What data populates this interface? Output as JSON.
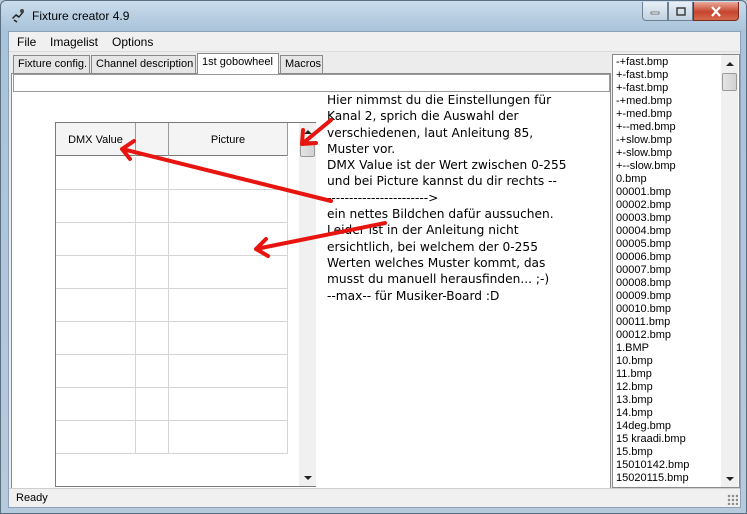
{
  "window": {
    "title": "Fixture creator 4.9"
  },
  "menu": [
    "File",
    "Imagelist",
    "Options"
  ],
  "tabs": [
    {
      "label": "Fixture config.",
      "active": false
    },
    {
      "label": "Channel description",
      "active": false
    },
    {
      "label": "1st gobowheel",
      "active": true
    },
    {
      "label": "Macros",
      "active": false
    }
  ],
  "grid": {
    "headers": {
      "dmx": "DMX Value",
      "mid": "",
      "picture": "Picture"
    },
    "empty_rows": 9
  },
  "note_lines": [
    "Hier nimmst du die Einstellungen für",
    "Kanal 2, sprich die Auswahl der",
    "verschiedenen, laut Anleitung 85,",
    "Muster vor.",
    "",
    "DMX Value ist der Wert zwischen 0-255",
    "und bei Picture kannst du dir rechts --",
    "-----------------------",
    "ein nettes Bildchen dafür aussuchen.",
    "",
    "Leider ist in der Anleitung nicht",
    "ersichtlich, bei welchem der 0-255",
    "Werten welches Muster kommt, das",
    "musst du manuell herausfinden... ;-)",
    "",
    "",
    "",
    "--max-- für Musiker-Board :D"
  ],
  "note_arrow_tail": ">",
  "image_list": [
    "-+fast.bmp",
    "+-fast.bmp",
    "+-fast.bmp",
    "-+med.bmp",
    "+-med.bmp",
    "+--med.bmp",
    "-+slow.bmp",
    "+-slow.bmp",
    "+--slow.bmp",
    "0.bmp",
    "00001.bmp",
    "00002.bmp",
    "00003.bmp",
    "00004.bmp",
    "00005.bmp",
    "00006.bmp",
    "00007.bmp",
    "00008.bmp",
    "00009.bmp",
    "00010.bmp",
    "00011.bmp",
    "00012.bmp",
    "1.BMP",
    "10.bmp",
    "11.bmp",
    "12.bmp",
    "13.bmp",
    "14.bmp",
    "14deg.bmp",
    "15 kraadi.bmp",
    "15.bmp",
    "15010142.bmp",
    "15020115.bmp"
  ],
  "status": "Ready",
  "colors": {
    "annotation_arrows": "#e8140f"
  }
}
